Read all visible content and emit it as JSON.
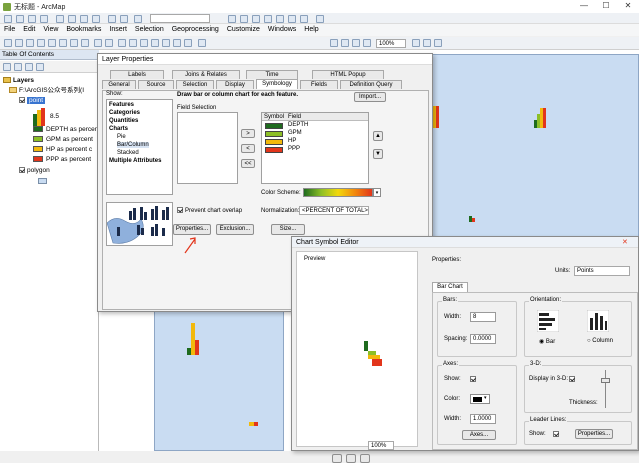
{
  "window": {
    "title": "无标题 - ArcMap",
    "minimize": "—",
    "maximize": "☐",
    "close": "✕"
  },
  "menu": [
    "File",
    "Edit",
    "View",
    "Bookmarks",
    "Insert",
    "Selection",
    "Geoprocessing",
    "Customize",
    "Windows",
    "Help"
  ],
  "toolbar": {
    "scale_value": "100%"
  },
  "toc": {
    "title": "Table Of Contents",
    "layers_root": "Layers",
    "folder": "F:\\ArcGIS公众号系列(I",
    "layer_point": "point",
    "size_label": "8.5",
    "fields": [
      {
        "label": "DEPTH as percent",
        "color": "#1e6b1e"
      },
      {
        "label": "GPM as percent",
        "color": "#8cbf26"
      },
      {
        "label": "HP as percent c",
        "color": "#f2b90c"
      },
      {
        "label": "PPP as percent",
        "color": "#e2351b"
      }
    ],
    "layer_polygon": "polygon"
  },
  "layer_properties": {
    "title": "Layer Properties",
    "tabs_row1": [
      "Labels",
      "Joins & Relates",
      "Time",
      "HTML Popup"
    ],
    "tabs_row2": [
      "General",
      "Source",
      "Selection",
      "Display",
      "Symbology",
      "Fields",
      "Definition Query"
    ],
    "show_label": "Show:",
    "show_items": [
      {
        "text": "Features",
        "bold": true,
        "indent": 0
      },
      {
        "text": "Categories",
        "bold": true,
        "indent": 0
      },
      {
        "text": "Quantities",
        "bold": true,
        "indent": 0
      },
      {
        "text": "Charts",
        "bold": true,
        "indent": 0
      },
      {
        "text": "Pie",
        "bold": false,
        "indent": 1
      },
      {
        "text": "Bar/Column",
        "bold": false,
        "indent": 1
      },
      {
        "text": "Stacked",
        "bold": false,
        "indent": 1
      },
      {
        "text": "Multiple Attributes",
        "bold": true,
        "indent": 0
      }
    ],
    "heading": "Draw bar or column chart for each feature.",
    "import_btn": "Import...",
    "field_selection": "Field Selection",
    "col_symbol": "Symbol",
    "col_field": "Field",
    "selected_fields": [
      {
        "field": "DEPTH",
        "color": "#1e6b1e"
      },
      {
        "field": "GPM",
        "color": "#8cbf26"
      },
      {
        "field": "HP",
        "color": "#f2b90c"
      },
      {
        "field": "PPP",
        "color": "#e2351b"
      }
    ],
    "move_right": ">",
    "move_left": "<",
    "move_all_left": "<<",
    "color_scheme": "Color Scheme:",
    "prevent_overlap": "Prevent chart overlap",
    "normalization": "Normalization:",
    "normalization_value": "<PERCENT OF TOTAL>",
    "properties_btn": "Properties...",
    "exclusion_btn": "Exclusion...",
    "size_btn": "Size..."
  },
  "chart_symbol_editor": {
    "title": "Chart Symbol Editor",
    "preview": "Preview",
    "properties": "Properties:",
    "units_label": "Units:",
    "units_value": "Points",
    "tab": "Bar Chart",
    "bars_group": "Bars:",
    "width_label": "Width:",
    "width_value": "8",
    "spacing_label": "Spacing:",
    "spacing_value": "0.0000",
    "orientation_group": "Orientation:",
    "bar_option": "Bar",
    "column_option": "Column",
    "axes_group": "Axes:",
    "show_label": "Show:",
    "color_label": "Color:",
    "axes_width_label": "Width:",
    "axes_width_value": "1.0000",
    "axes_btn": "Axes...",
    "three_d_group": "3-D:",
    "display_3d": "Display in 3-D:",
    "thickness": "Thickness:",
    "leader_group": "Leader Lines:",
    "leader_show": "Show:",
    "leader_properties": "Properties...",
    "zoom_value": "100%"
  }
}
